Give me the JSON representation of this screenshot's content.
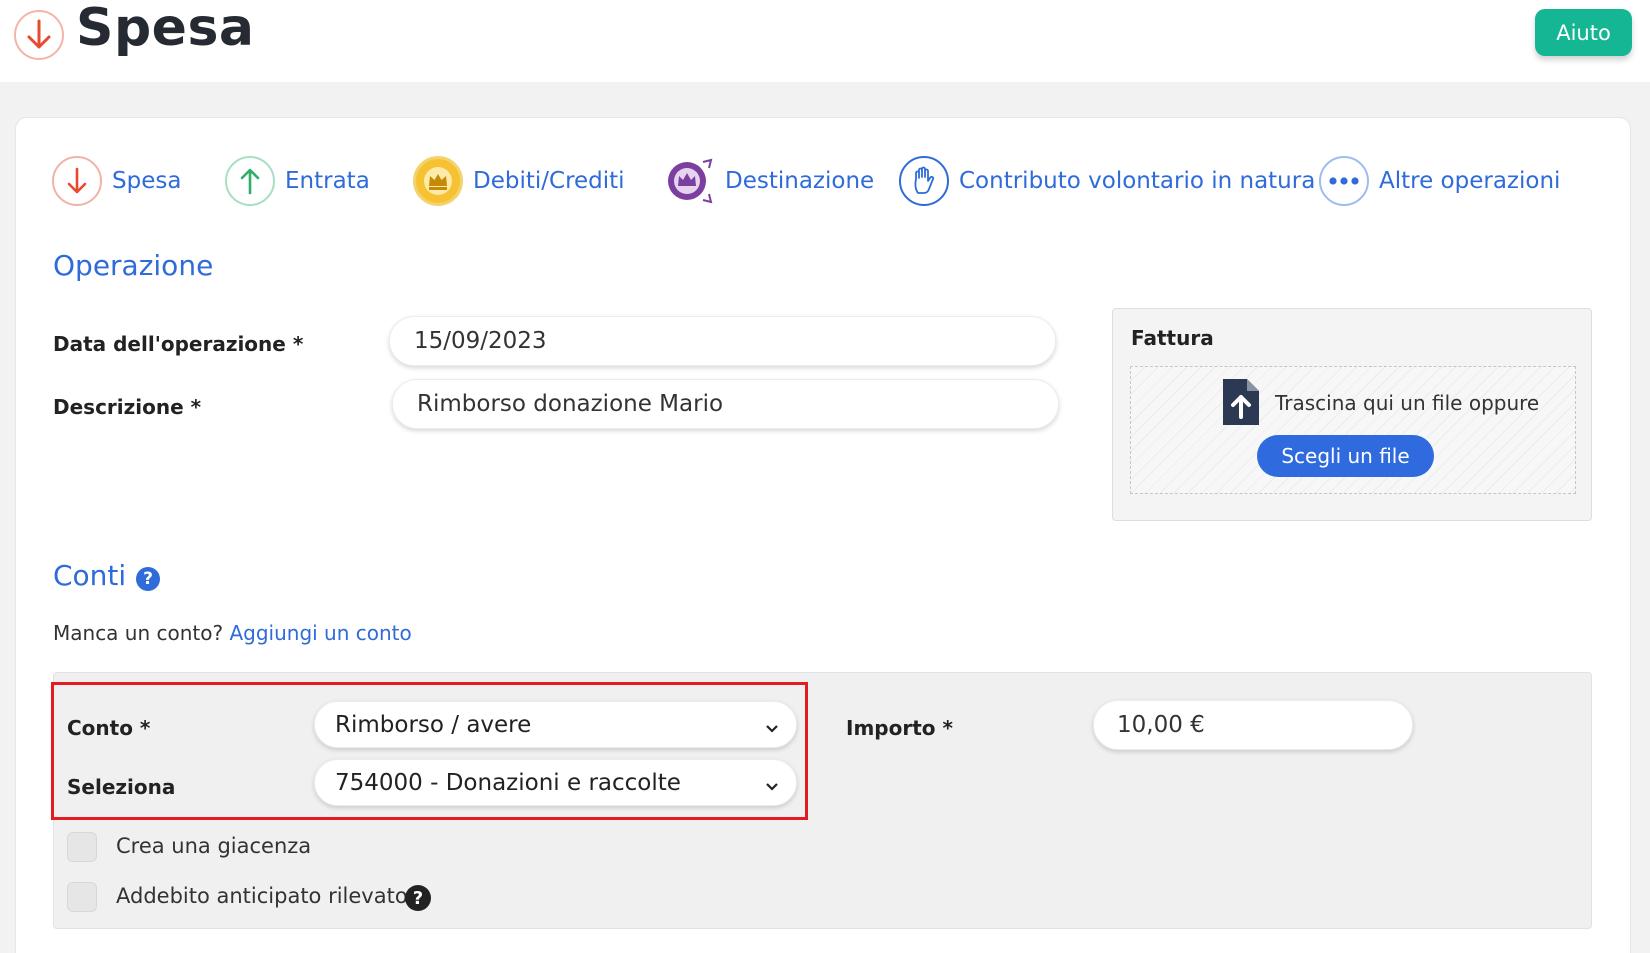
{
  "header": {
    "title": "Spesa",
    "help_label": "Aiuto"
  },
  "operation_types": [
    {
      "label": "Spesa",
      "icon": "arrow-down-icon",
      "color": "#e8492f"
    },
    {
      "label": "Entrata",
      "icon": "arrow-up-icon",
      "color": "#2fae6a"
    },
    {
      "label": "Debiti/Crediti",
      "icon": "crown-icon",
      "color": "#f2b51c"
    },
    {
      "label": "Destinazione",
      "icon": "crown-transfer-icon",
      "color": "#7b3fa0"
    },
    {
      "label": "Contributo volontario in natura",
      "icon": "hand-icon",
      "color": "#2f6bd9"
    },
    {
      "label": "Altre operazioni",
      "icon": "more-dots-icon",
      "color": "#2f6bd9"
    }
  ],
  "operazione": {
    "section_title": "Operazione",
    "date_label": "Data dell'operazione *",
    "date_value": "15/09/2023",
    "description_label": "Descrizione *",
    "description_value": "Rimborso donazione Mario"
  },
  "fattura": {
    "title": "Fattura",
    "drop_text": "Trascina qui un file oppure",
    "choose_label": "Scegli un file"
  },
  "conti": {
    "section_title": "Conti",
    "help_glyph": "?",
    "missing_text": "Manca un conto?",
    "add_link": "Aggiungi un conto",
    "conto_label": "Conto *",
    "conto_value": "Rimborso / avere",
    "seleziona_label": "Seleziona",
    "seleziona_value": "754000 - Donazioni e raccolte",
    "importo_label": "Importo *",
    "importo_value": "10,00 €",
    "checkbox_giacenza": "Crea una giacenza",
    "checkbox_addebito": "Addebito anticipato rilevato",
    "addebito_help_glyph": "?"
  },
  "colors": {
    "accent_blue": "#2f6bd9",
    "help_green": "#14b693",
    "highlight_red": "#e31b23"
  }
}
